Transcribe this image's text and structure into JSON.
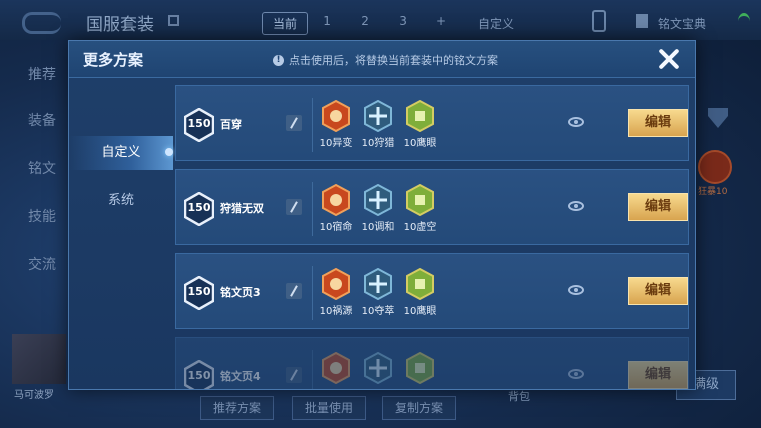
{
  "background": {
    "title": "国服套装",
    "tabs": [
      "当前",
      "1",
      "2",
      "3",
      "+"
    ],
    "custom_label": "自定义",
    "dict_label": "铭文宝典",
    "nav": [
      "推荐",
      "装备",
      "铭文",
      "技能",
      "交流"
    ],
    "hero_name": "马可波罗",
    "emblem_label": "狂暴10",
    "bag_label": "背包",
    "upgrade_label": "满级",
    "bottom_buttons": [
      "推荐方案",
      "批量使用",
      "复制方案"
    ]
  },
  "modal": {
    "title": "更多方案",
    "hint": "点击使用后，将替换当前套装中的铭文方案",
    "close_icon": "close-icon"
  },
  "sidebar": {
    "items": [
      {
        "label": "自定义",
        "active": true
      },
      {
        "label": "系统",
        "active": false
      }
    ]
  },
  "plans": [
    {
      "level": "150",
      "name": "百穿",
      "inscriptions": [
        {
          "label": "10异变",
          "color": "red",
          "icon": "red-inscription-icon"
        },
        {
          "label": "10狩猎",
          "color": "blue",
          "icon": "blue-inscription-icon"
        },
        {
          "label": "10鹰眼",
          "color": "green",
          "icon": "green-inscription-icon"
        }
      ],
      "edit_label": "编辑"
    },
    {
      "level": "150",
      "name": "狩猎无双",
      "inscriptions": [
        {
          "label": "10宿命",
          "color": "red",
          "icon": "red-inscription-icon"
        },
        {
          "label": "10调和",
          "color": "blue",
          "icon": "blue-inscription-icon"
        },
        {
          "label": "10虚空",
          "color": "green",
          "icon": "green-inscription-icon"
        }
      ],
      "edit_label": "编辑"
    },
    {
      "level": "150",
      "name": "铭文页3",
      "inscriptions": [
        {
          "label": "10祸源",
          "color": "red",
          "icon": "red-inscription-icon"
        },
        {
          "label": "10夺萃",
          "color": "blue",
          "icon": "blue-inscription-icon"
        },
        {
          "label": "10鹰眼",
          "color": "green",
          "icon": "green-inscription-icon"
        }
      ],
      "edit_label": "编辑"
    },
    {
      "level": "150",
      "name": "铭文页4",
      "inscriptions": [
        {
          "label": "",
          "color": "red",
          "icon": "red-inscription-icon"
        },
        {
          "label": "",
          "color": "blue",
          "icon": "blue-inscription-icon"
        },
        {
          "label": "",
          "color": "green",
          "icon": "green-inscription-icon"
        }
      ],
      "edit_label": "编辑"
    }
  ],
  "colors": {
    "red": "#c8481e",
    "blue": "#7fb7d8",
    "green": "#7fae3a",
    "accent_gold": "#e6bd6a"
  }
}
